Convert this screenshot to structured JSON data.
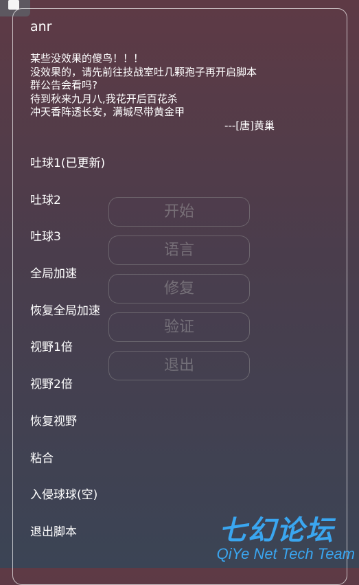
{
  "title": "anr",
  "notice": {
    "lines": [
      "某些没效果的傻鸟！！！",
      "没效果的，请先前往技战室吐几颗孢子再开启脚本",
      "群公告会看吗?",
      "待到秋来九月八,我花开后百花杀",
      "冲天香阵透长安，满城尽带黄金甲"
    ],
    "signature": "---[唐]黄巢"
  },
  "menu": [
    "吐球1(已更新)",
    "吐球2",
    "吐球3",
    "全局加速",
    "恢复全局加速",
    "视野1倍",
    "视野2倍",
    "恢复视野",
    "粘合",
    "入侵球球(空)",
    "退出脚本"
  ],
  "buttons": [
    "开始",
    "语言",
    "修复",
    "验证",
    "退出"
  ],
  "watermark": {
    "cn": "七幻论坛",
    "en": "QiYe Net Tech Team"
  }
}
